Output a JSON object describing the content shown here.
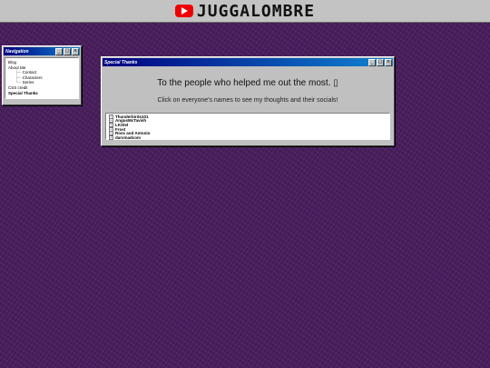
{
  "header": {
    "brand": "JUGGALOMBRE",
    "logo_icon": "youtube-icon"
  },
  "navigation": {
    "title": "Navigation",
    "items": [
      {
        "label": "Blog",
        "level": 0
      },
      {
        "label": "About Me",
        "level": 0
      },
      {
        "label": "Contact",
        "level": 1
      },
      {
        "label": "Characters",
        "level": 1
      },
      {
        "label": "Series",
        "level": 1
      },
      {
        "label": "CSS credit",
        "level": 0
      },
      {
        "label": "Special Thanks",
        "level": 0,
        "active": true
      }
    ]
  },
  "special": {
    "title": "Special Thanks",
    "heading": "To the people who helped me out the most. ▯",
    "subheading": "Click on everyone's names to see my thoughts and their socials!",
    "names": [
      "Thunderbirds101",
      "AngusMcTavish",
      "LKStel",
      "Frost",
      "Ross and Antonio",
      "darvmadcom"
    ]
  },
  "window_controls": {
    "minimize": "_",
    "maximize": "□",
    "close": "×"
  }
}
